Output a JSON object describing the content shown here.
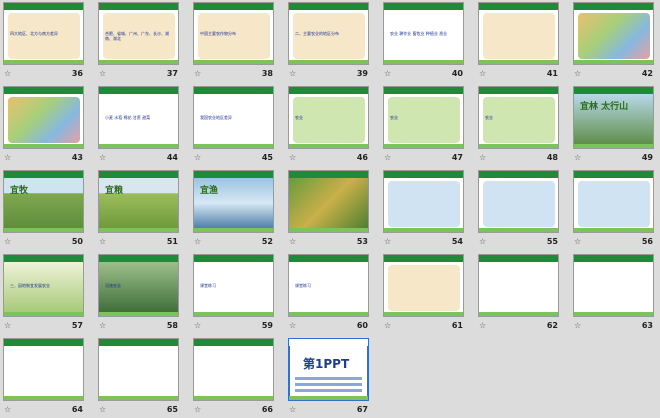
{
  "slides": [
    {
      "num": "36",
      "kind": "mapcn",
      "text": "四大地区、北方与南方差异"
    },
    {
      "num": "37",
      "kind": "mapcn",
      "text": "合肥、省城、广州、广东、长沙、湖南、湖北"
    },
    {
      "num": "38",
      "kind": "mapcn",
      "text": "中国主要农作物分布"
    },
    {
      "num": "39",
      "kind": "map2",
      "text": "二、主要农业的地区分布"
    },
    {
      "num": "40",
      "kind": "table",
      "text": "农业 耕作业 畜牧业 种植业 渔业"
    },
    {
      "num": "41",
      "kind": "mapcn",
      "text": ""
    },
    {
      "num": "42",
      "kind": "mapcolor",
      "text": ""
    },
    {
      "num": "43",
      "kind": "mapcolor",
      "text": ""
    },
    {
      "num": "44",
      "kind": "table",
      "text": "小麦 水稻 棉花 甘蔗 甜菜"
    },
    {
      "num": "45",
      "kind": "people",
      "text": "我国农业地区差异"
    },
    {
      "num": "46",
      "kind": "map3",
      "text": "农业"
    },
    {
      "num": "47",
      "kind": "map3",
      "text": "农业"
    },
    {
      "num": "48",
      "kind": "map3",
      "text": "农业"
    },
    {
      "num": "49",
      "kind": "forest",
      "text": "宜林 太行山"
    },
    {
      "num": "50",
      "kind": "grass",
      "text": "宜牧"
    },
    {
      "num": "51",
      "kind": "field",
      "text": "宜粮"
    },
    {
      "num": "52",
      "kind": "lake",
      "text": "宜渔"
    },
    {
      "num": "53",
      "kind": "aerial",
      "text": ""
    },
    {
      "num": "54",
      "kind": "terrain",
      "text": ""
    },
    {
      "num": "55",
      "kind": "terrain",
      "text": ""
    },
    {
      "num": "56",
      "kind": "terrain",
      "text": ""
    },
    {
      "num": "57",
      "kind": "photo2",
      "text": "三、因地制宜发展农业"
    },
    {
      "num": "58",
      "kind": "greenhouse",
      "text": "设施农业"
    },
    {
      "num": "59",
      "kind": "quiz",
      "text": "课堂练习"
    },
    {
      "num": "60",
      "kind": "quiz",
      "text": "课堂练习"
    },
    {
      "num": "61",
      "kind": "quizmap",
      "text": ""
    },
    {
      "num": "62",
      "kind": "quiz",
      "text": ""
    },
    {
      "num": "63",
      "kind": "quiz",
      "text": ""
    },
    {
      "num": "64",
      "kind": "quiz",
      "text": ""
    },
    {
      "num": "65",
      "kind": "quizimg",
      "text": ""
    },
    {
      "num": "66",
      "kind": "quizimg",
      "text": ""
    },
    {
      "num": "67",
      "kind": "end",
      "text": "第1PPT"
    }
  ],
  "selected": "67",
  "marker": "☆"
}
